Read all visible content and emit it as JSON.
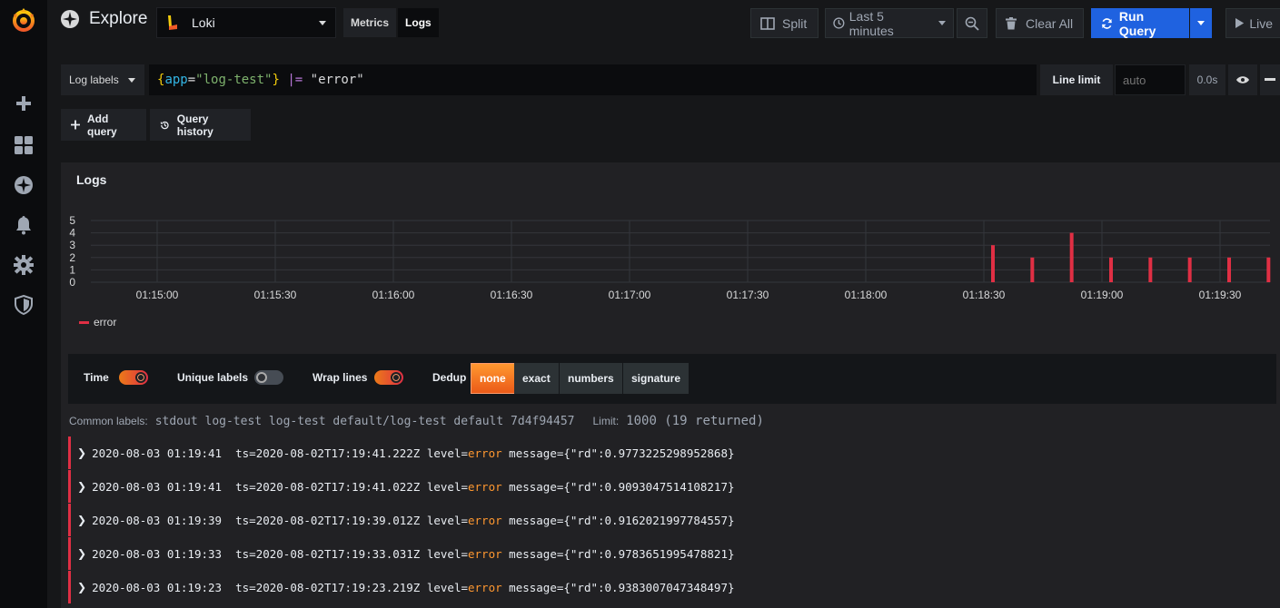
{
  "header": {
    "title": "Explore",
    "datasource": "Loki",
    "modes": [
      {
        "label": "Metrics",
        "active": false
      },
      {
        "label": "Logs",
        "active": true
      }
    ],
    "split_label": "Split",
    "time_range": "Last 5 minutes",
    "clear_label": "Clear All",
    "run_label": "Run Query",
    "live_label": "Live"
  },
  "query": {
    "log_labels": "Log labels",
    "brace_open": "{",
    "key": "app",
    "eq": "=",
    "value": "\"log-test\"",
    "brace_close": "}",
    "pipe": "|=",
    "filter": "\"error\"",
    "line_limit_label": "Line limit",
    "line_limit_placeholder": "auto",
    "elapsed": "0.0s",
    "add_query": "Add query",
    "query_history": "Query history"
  },
  "panel": {
    "title": "Logs",
    "legend": "error",
    "options": {
      "time": "Time",
      "unique": "Unique labels",
      "wrap": "Wrap lines",
      "dedup": "Dedup",
      "dedup_options": [
        "none",
        "exact",
        "numbers",
        "signature"
      ]
    },
    "common_labels_label": "Common labels:",
    "common_labels": "stdout log-test log-test default/log-test default 7d4f94457",
    "limit_label": "Limit:",
    "limit_value": "1000 (19 returned)"
  },
  "chart_data": {
    "type": "bar",
    "x_ticks": [
      "01:15:00",
      "01:15:30",
      "01:16:00",
      "01:16:30",
      "01:17:00",
      "01:17:30",
      "01:18:00",
      "01:18:30",
      "01:19:00",
      "01:19:30"
    ],
    "y_ticks": [
      0,
      1,
      2,
      3,
      4,
      5
    ],
    "ylim": [
      0,
      5
    ],
    "series": [
      {
        "name": "error",
        "color": "#e02f44",
        "points": [
          {
            "t": "01:18:30",
            "v": 3
          },
          {
            "t": "01:18:40",
            "v": 2
          },
          {
            "t": "01:18:50",
            "v": 4
          },
          {
            "t": "01:19:00",
            "v": 2
          },
          {
            "t": "01:19:10",
            "v": 2
          },
          {
            "t": "01:19:20",
            "v": 2
          },
          {
            "t": "01:19:30",
            "v": 2
          },
          {
            "t": "01:19:40",
            "v": 2
          }
        ]
      }
    ]
  },
  "logs": [
    {
      "ts": "2020-08-03 01:19:41",
      "pre": "ts=2020-08-02T17:19:41.222Z level=",
      "level": "error",
      "post": " message={\"rd\":0.9773225298952868}"
    },
    {
      "ts": "2020-08-03 01:19:41",
      "pre": "ts=2020-08-02T17:19:41.022Z level=",
      "level": "error",
      "post": " message={\"rd\":0.9093047514108217}"
    },
    {
      "ts": "2020-08-03 01:19:39",
      "pre": "ts=2020-08-02T17:19:39.012Z level=",
      "level": "error",
      "post": " message={\"rd\":0.9162021997784557}"
    },
    {
      "ts": "2020-08-03 01:19:33",
      "pre": "ts=2020-08-02T17:19:33.031Z level=",
      "level": "error",
      "post": " message={\"rd\":0.9783651995478821}"
    },
    {
      "ts": "2020-08-03 01:19:23",
      "pre": "ts=2020-08-02T17:19:23.219Z level=",
      "level": "error",
      "post": " message={\"rd\":0.9383007047348497}"
    }
  ],
  "icons": {
    "sidebar": [
      "grafana-logo-icon",
      "plus-icon",
      "dashboards-icon",
      "explore-compass-icon",
      "bell-icon",
      "gear-icon",
      "shield-icon"
    ]
  }
}
